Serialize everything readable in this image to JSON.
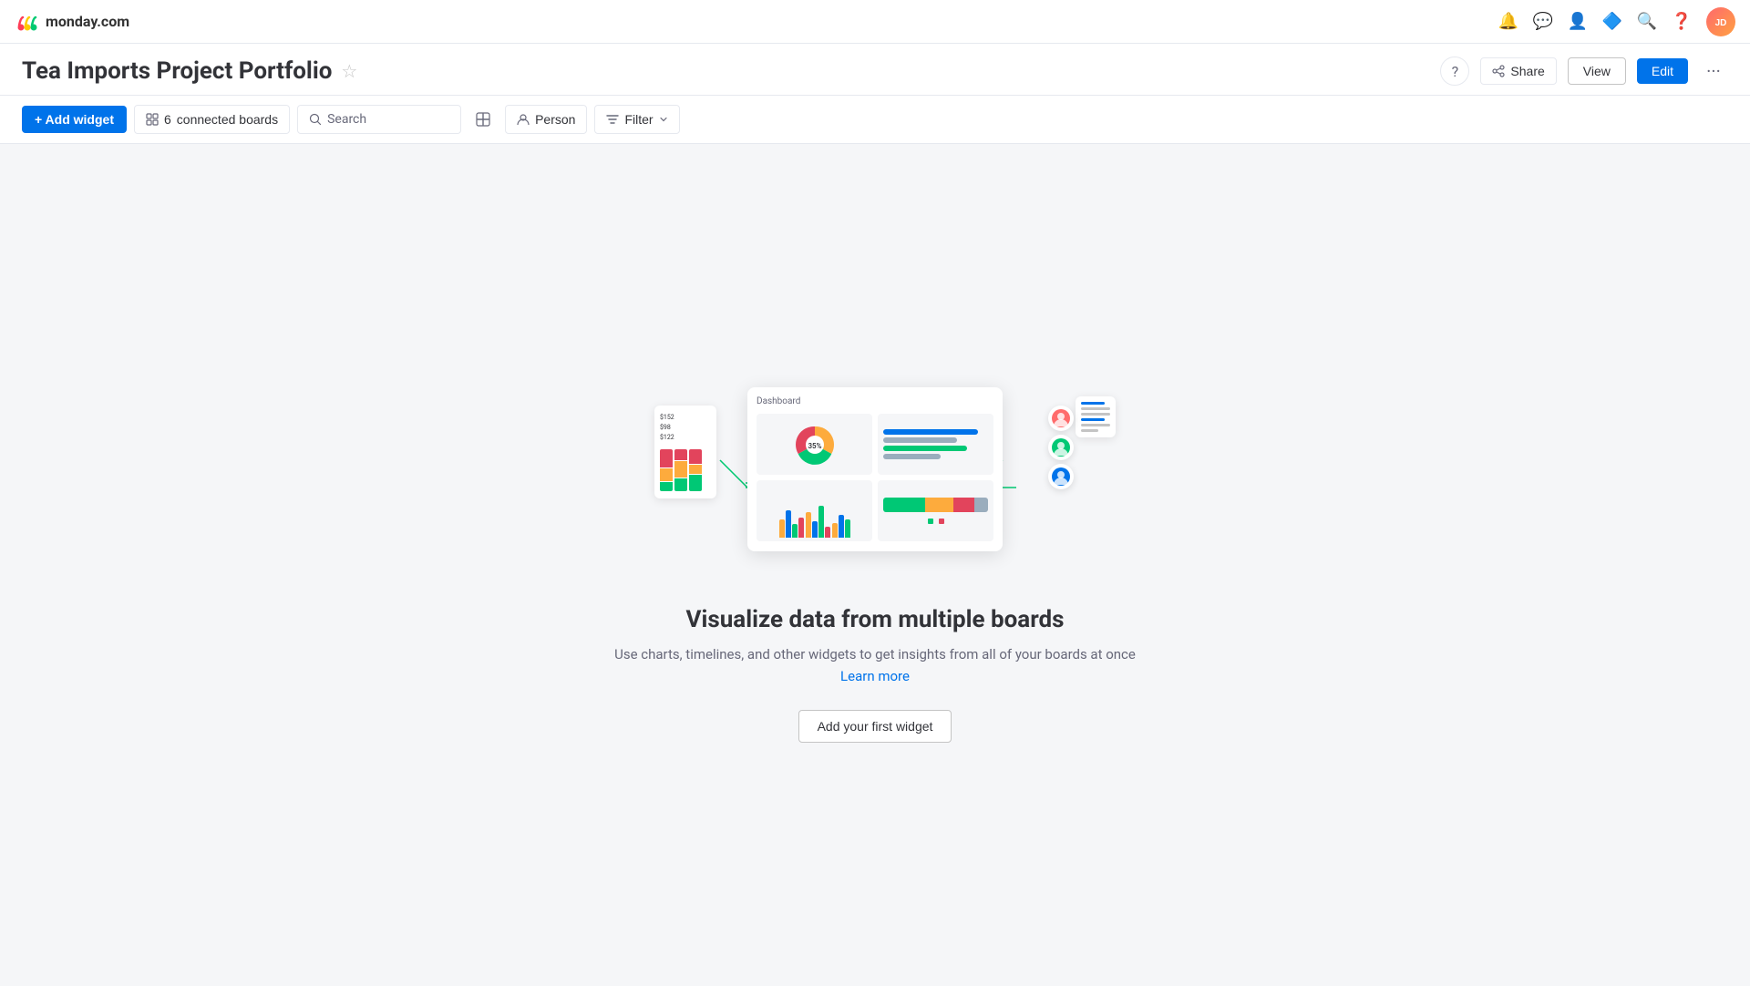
{
  "app": {
    "name": "monday.com"
  },
  "topbar": {
    "icons": [
      "bell",
      "chat",
      "people",
      "apps",
      "search",
      "help"
    ],
    "avatar_initials": "JD"
  },
  "page": {
    "title": "Tea Imports Project Portfolio",
    "view_label": "View",
    "edit_label": "Edit",
    "share_label": "Share",
    "help_label": "?"
  },
  "toolbar": {
    "add_widget_label": "+ Add widget",
    "connected_boards_count": "6",
    "connected_boards_label": "connected boards",
    "search_placeholder": "Search",
    "person_label": "Person",
    "filter_label": "Filter"
  },
  "main": {
    "headline": "Visualize data from multiple boards",
    "subtext": "Use charts, timelines, and other widgets to get insights from all of your boards at once",
    "learn_more_label": "Learn more",
    "add_first_widget_label": "Add your first widget",
    "dashboard_card_title": "Dashboard"
  }
}
